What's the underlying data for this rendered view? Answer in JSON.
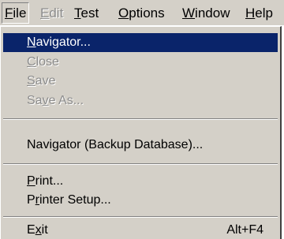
{
  "menubar": {
    "items": [
      {
        "mnemonic": "F",
        "rest": "ile",
        "state": "pressed"
      },
      {
        "mnemonic": "E",
        "rest": "dit",
        "state": "disabled"
      },
      {
        "mnemonic": "T",
        "rest": "est",
        "state": "enabled"
      },
      {
        "mnemonic": "O",
        "rest": "ptions",
        "state": "enabled"
      },
      {
        "mnemonic": "W",
        "rest": "indow",
        "state": "enabled"
      },
      {
        "mnemonic": "H",
        "rest": "elp",
        "state": "enabled"
      }
    ]
  },
  "file_menu": {
    "items": [
      {
        "pre": "",
        "mnemonic": "N",
        "post": "avigator...",
        "shortcut": "",
        "state": "selected"
      },
      {
        "pre": "",
        "mnemonic": "C",
        "post": "lose",
        "shortcut": "",
        "state": "disabled"
      },
      {
        "pre": "",
        "mnemonic": "S",
        "post": "ave",
        "shortcut": "",
        "state": "disabled"
      },
      {
        "pre": "Sa",
        "mnemonic": "v",
        "post": "e As...",
        "shortcut": "",
        "state": "disabled"
      },
      {
        "pre": "Navi",
        "mnemonic": "g",
        "post": "ator (Backup Database)...",
        "shortcut": "",
        "state": "enabled"
      },
      {
        "pre": "",
        "mnemonic": "P",
        "post": "rint...",
        "shortcut": "",
        "state": "enabled"
      },
      {
        "pre": "P",
        "mnemonic": "r",
        "post": "inter Setup...",
        "shortcut": "",
        "state": "enabled"
      },
      {
        "pre": "E",
        "mnemonic": "x",
        "post": "it",
        "shortcut": "Alt+F4",
        "state": "enabled"
      }
    ]
  },
  "colors": {
    "menu_face": "#d4d0c8",
    "selection": "#0a246a",
    "disabled_text": "#8c8c8c"
  }
}
